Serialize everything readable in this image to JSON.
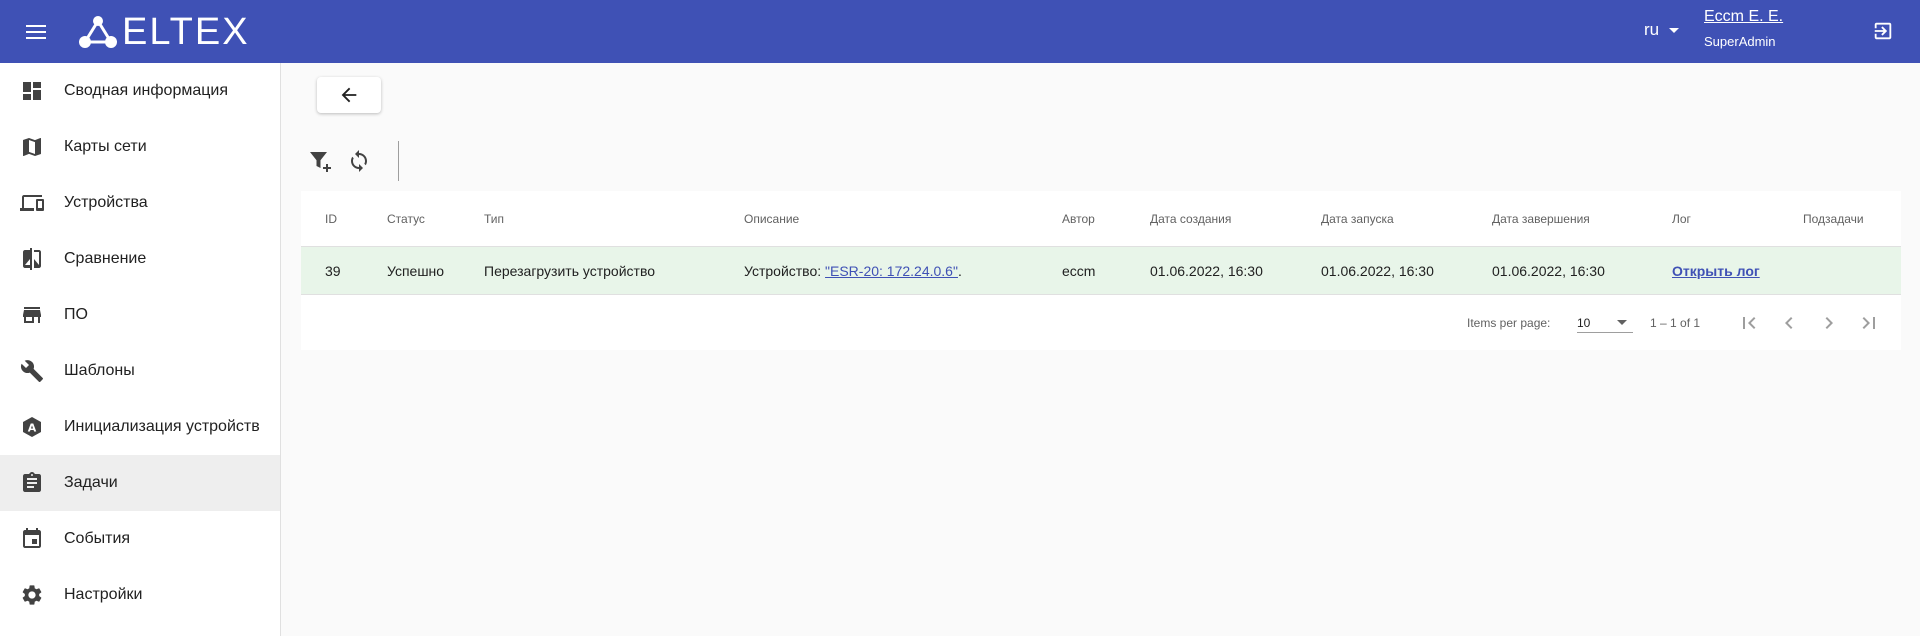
{
  "header": {
    "logo_text": "ELTEX",
    "language": "ru",
    "user_name": "Eccm E. E.",
    "user_role": "SuperAdmin"
  },
  "sidebar": {
    "items": [
      {
        "label": "Сводная информация",
        "icon": "dashboard-icon"
      },
      {
        "label": "Карты сети",
        "icon": "map-icon"
      },
      {
        "label": "Устройства",
        "icon": "devices-icon"
      },
      {
        "label": "Сравнение",
        "icon": "compare-icon"
      },
      {
        "label": "ПО",
        "icon": "store-icon"
      },
      {
        "label": "Шаблоны",
        "icon": "wrench-icon"
      },
      {
        "label": "Инициализация устройств",
        "icon": "initialization-icon"
      },
      {
        "label": "Задачи",
        "icon": "clipboard-icon",
        "active": true
      },
      {
        "label": "События",
        "icon": "calendar-icon"
      },
      {
        "label": "Настройки",
        "icon": "gear-icon"
      }
    ]
  },
  "table": {
    "columns": {
      "id": "ID",
      "status": "Статус",
      "type": "Тип",
      "description": "Описание",
      "author": "Автор",
      "created": "Дата создания",
      "started": "Дата запуска",
      "finished": "Дата завершения",
      "log": "Лог",
      "subtasks": "Подзадачи"
    },
    "rows": [
      {
        "id": "39",
        "status": "Успешно",
        "type": "Перезагрузить устройство",
        "description_prefix": "Устройство: ",
        "description_link": "\"ESR-20: 172.24.0.6\"",
        "description_suffix": ".",
        "author": "eccm",
        "created": "01.06.2022, 16:30",
        "started": "01.06.2022, 16:30",
        "finished": "01.06.2022, 16:30",
        "log_link": "Открыть лог",
        "subtasks": ""
      }
    ]
  },
  "paginator": {
    "items_per_page_label": "Items per page:",
    "items_per_page_value": "10",
    "range_label": "1 – 1 of 1"
  },
  "colors": {
    "header_bg": "#3f51b5",
    "row_success_bg": "#e8f5e9",
    "link": "#3f51b5"
  }
}
